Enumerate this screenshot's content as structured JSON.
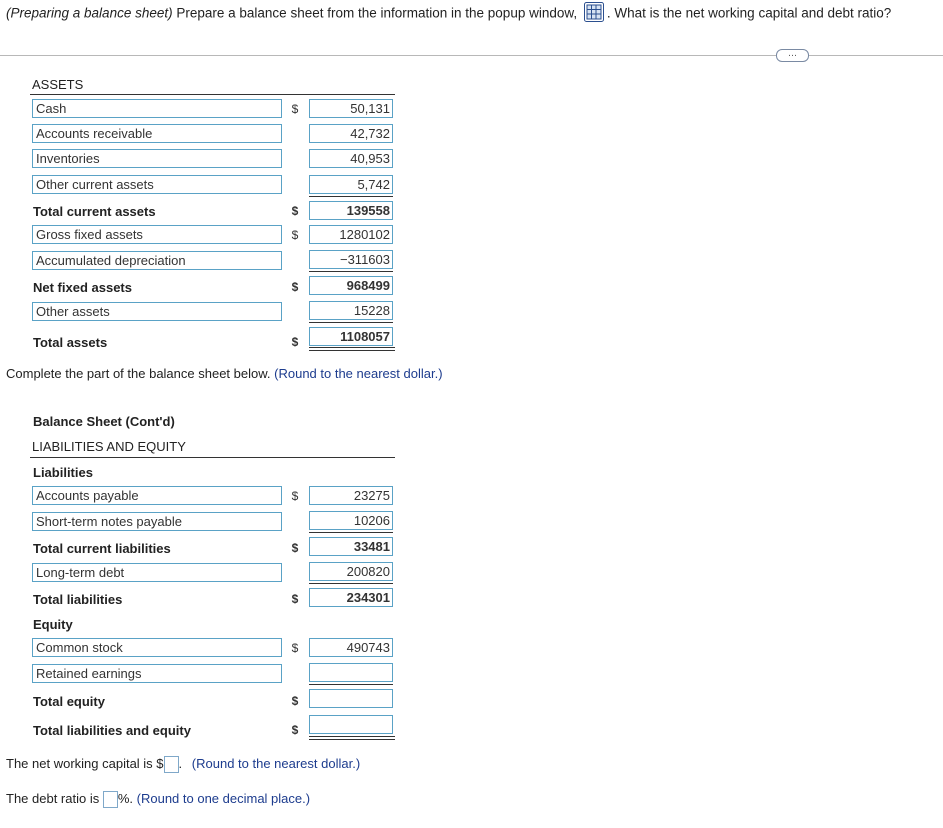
{
  "question": {
    "prefix": "(Preparing a balance sheet)",
    "text": " Prepare a balance sheet from the information in the popup window,",
    "icon": "table-popup-icon",
    "text2": ". What is the net working capital and debt ratio?"
  },
  "more_button": "…",
  "assets": {
    "header": "ASSETS",
    "rows": [
      {
        "label": "Cash",
        "dollar": "$",
        "value": "50,131"
      },
      {
        "label": "Accounts receivable",
        "dollar": "",
        "value": "42,732"
      },
      {
        "label": "Inventories",
        "dollar": "",
        "value": "40,953"
      },
      {
        "label": "Other current assets",
        "dollar": "",
        "value": "5,742"
      },
      {
        "label": "Total current assets",
        "dollar": "$",
        "value": "139558"
      },
      {
        "label": "Gross fixed assets",
        "dollar": "$",
        "value": "1280102"
      },
      {
        "label": "Accumulated depreciation",
        "dollar": "",
        "value": "−311603"
      },
      {
        "label": "Net fixed assets",
        "dollar": "$",
        "value": "968499"
      },
      {
        "label": "Other assets",
        "dollar": "",
        "value": "15228"
      },
      {
        "label": "Total assets",
        "dollar": "$",
        "value": "1108057"
      }
    ]
  },
  "instruction": {
    "text": "Complete the part of the balance sheet below.",
    "hint": "(Round to the nearest dollar.)"
  },
  "liab": {
    "title": "Balance Sheet (Cont'd)",
    "header": "LIABILITIES AND EQUITY",
    "liabilities_label": "Liabilities",
    "equity_label": "Equity",
    "rows": [
      {
        "label": "Accounts payable",
        "dollar": "$",
        "value": "23275"
      },
      {
        "label": "Short-term notes payable",
        "dollar": "",
        "value": "10206"
      },
      {
        "label": "Total current liabilities",
        "dollar": "$",
        "value": "33481"
      },
      {
        "label": "Long-term debt",
        "dollar": "",
        "value": "200820"
      },
      {
        "label": "Total liabilities",
        "dollar": "$",
        "value": "234301"
      },
      {
        "label": "Common stock",
        "dollar": "$",
        "value": "490743"
      },
      {
        "label": "Retained earnings",
        "dollar": "",
        "value": ""
      },
      {
        "label": "Total equity",
        "dollar": "$",
        "value": ""
      },
      {
        "label": "Total liabilities and equity",
        "dollar": "$",
        "value": ""
      }
    ]
  },
  "nwc": {
    "prefix": "The net working capital is $",
    "value": "",
    "suffix": ".",
    "hint": "(Round to the nearest dollar.)"
  },
  "debt_ratio": {
    "prefix": "The debt ratio is",
    "value": "",
    "suffix": "%.",
    "hint": "(Round to one decimal place.)"
  }
}
